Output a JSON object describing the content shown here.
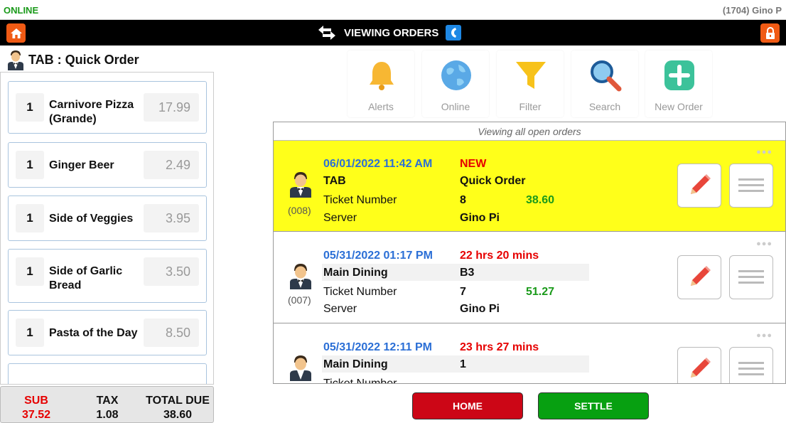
{
  "status": {
    "connection": "ONLINE",
    "user": "(1704) Gino P"
  },
  "topbar": {
    "title": "VIEWING ORDERS"
  },
  "tab": {
    "title": "TAB : Quick Order"
  },
  "items": [
    {
      "qty": "1",
      "name": "Carnivore Pizza (Grande)",
      "price": "17.99"
    },
    {
      "qty": "1",
      "name": "Ginger Beer",
      "price": "2.49"
    },
    {
      "qty": "1",
      "name": "Side of Veggies",
      "price": "3.95"
    },
    {
      "qty": "1",
      "name": "Side of Garlic Bread",
      "price": "3.50"
    },
    {
      "qty": "1",
      "name": "Pasta of the Day",
      "price": "8.50"
    }
  ],
  "totals": {
    "sub_label": "SUB",
    "sub_value": "37.52",
    "tax_label": "TAX",
    "tax_value": "1.08",
    "total_label": "TOTAL DUE",
    "total_value": "38.60"
  },
  "actions": [
    {
      "label": "Alerts",
      "icon": "bell-icon"
    },
    {
      "label": "Online",
      "icon": "globe-icon"
    },
    {
      "label": "Filter",
      "icon": "funnel-icon"
    },
    {
      "label": "Search",
      "icon": "magnifier-icon"
    },
    {
      "label": "New Order",
      "icon": "plus-icon"
    }
  ],
  "orders_caption": "Viewing all open orders",
  "orders": [
    {
      "number": "(008)",
      "datetime": "06/01/2022 11:42 AM",
      "status": "NEW",
      "type": "TAB",
      "name": "Quick Order",
      "ticket_label": "Ticket Number",
      "ticket": "8",
      "total": "38.60",
      "server_label": "Server",
      "server": "Gino Pi"
    },
    {
      "number": "(007)",
      "datetime": "05/31/2022 01:17 PM",
      "status": "22 hrs 20 mins",
      "type": "Main Dining",
      "name": "B3",
      "ticket_label": "Ticket Number",
      "ticket": "7",
      "total": "51.27",
      "server_label": "Server",
      "server": "Gino Pi"
    },
    {
      "number": "",
      "datetime": "05/31/2022 12:11 PM",
      "status": "23 hrs 27 mins",
      "type": "Main Dining",
      "name": "1",
      "ticket_label": "Ticket Number",
      "ticket": "",
      "total": "",
      "server_label": "",
      "server": ""
    }
  ],
  "buttons": {
    "home": "HOME",
    "settle": "SETTLE"
  },
  "colors": {
    "accent": "#f05a14",
    "highlight": "#ffff1a",
    "home": "#cc0616",
    "settle": "#07a011",
    "date": "#2b6fd6"
  }
}
